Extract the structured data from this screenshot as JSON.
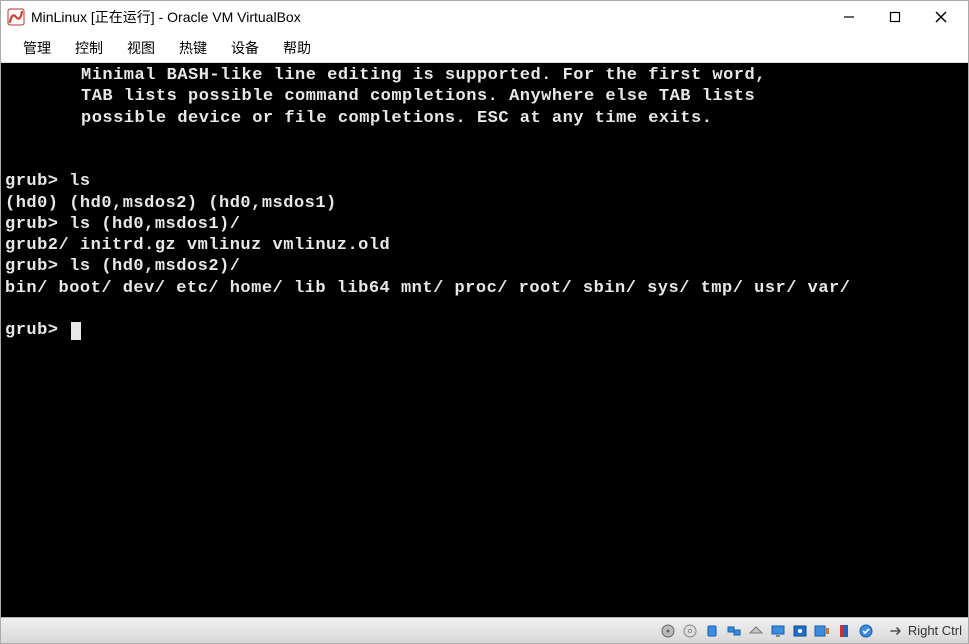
{
  "window": {
    "title": "MinLinux [正在运行] - Oracle VM VirtualBox"
  },
  "menu": {
    "items": [
      "管理",
      "控制",
      "视图",
      "热键",
      "设备",
      "帮助"
    ]
  },
  "console": {
    "intro1": "Minimal BASH-like line editing is supported. For the first word,",
    "intro2": "TAB lists possible command completions. Anywhere else TAB lists",
    "intro3": "possible device or file completions. ESC at any time exits.",
    "prompt1": "grub> ls",
    "out1": "(hd0) (hd0,msdos2) (hd0,msdos1)",
    "prompt2": "grub> ls (hd0,msdos1)/",
    "out2": "grub2/ initrd.gz vmlinuz vmlinuz.old",
    "prompt3": "grub> ls (hd0,msdos2)/",
    "out3": "bin/ boot/ dev/ etc/ home/ lib lib64 mnt/ proc/ root/ sbin/ sys/ tmp/ usr/ var/",
    "prompt4": "grub> "
  },
  "status": {
    "hostkey": "Right Ctrl"
  }
}
